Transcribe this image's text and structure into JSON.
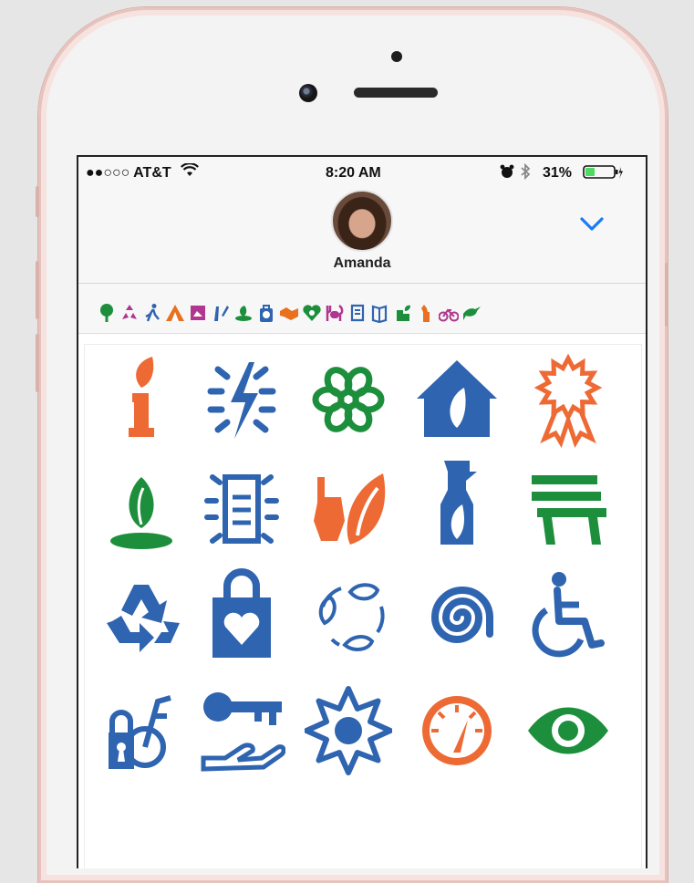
{
  "status_bar": {
    "carrier": "●●○○○ AT&T",
    "time": "8:20 AM",
    "battery_percent": "31%"
  },
  "conversation": {
    "contact_name": "Amanda"
  },
  "sticker_strip": {
    "icons": [
      "tree-icon",
      "recycle-icon",
      "runner-icon",
      "camping-tent-icon",
      "photo-icon",
      "paintbrush-icon",
      "hand-leaf-icon",
      "bag-icon",
      "handshake-icon",
      "heart-flower-icon",
      "dining-icon",
      "scroll-icon",
      "book-icon",
      "planting-icon",
      "statue-of-liberty-icon",
      "bicycle-icon",
      "bird-icon"
    ]
  },
  "stickers": [
    {
      "name": "info-leaf-icon",
      "color": "#ee6a35"
    },
    {
      "name": "energy-bolt-icon",
      "color": "#2f64b0"
    },
    {
      "name": "flower-icon",
      "color": "#1d8f3c"
    },
    {
      "name": "leaf-house-icon",
      "color": "#2f64b0"
    },
    {
      "name": "award-ribbon-icon",
      "color": "#ee6a35"
    },
    {
      "name": "sprout-icon",
      "color": "#1d8f3c"
    },
    {
      "name": "document-glow-icon",
      "color": "#2f64b0"
    },
    {
      "name": "hand-leaf-pledge-icon",
      "color": "#ee6a35"
    },
    {
      "name": "spray-bottle-leaf-icon",
      "color": "#2f64b0"
    },
    {
      "name": "park-bench-icon",
      "color": "#1d8f3c"
    },
    {
      "name": "recycle-arrows-icon",
      "color": "#2f64b0"
    },
    {
      "name": "heart-shopping-bag-icon",
      "color": "#2f64b0"
    },
    {
      "name": "leaf-cycle-icon",
      "color": "#2f64b0"
    },
    {
      "name": "spiral-icon",
      "color": "#2f64b0"
    },
    {
      "name": "wheelchair-icon",
      "color": "#2f64b0"
    },
    {
      "name": "bike-lock-icon",
      "color": "#2f64b0"
    },
    {
      "name": "key-hand-icon",
      "color": "#2f64b0"
    },
    {
      "name": "sun-burst-icon",
      "color": "#2f64b0"
    },
    {
      "name": "speedometer-icon",
      "color": "#ee6a35"
    },
    {
      "name": "eye-icon",
      "color": "#1d8f3c"
    }
  ],
  "colors": {
    "accent_blue": "#1a7cf5",
    "battery_green": "#4cd964",
    "phone_frame": "#e7c3bd"
  }
}
